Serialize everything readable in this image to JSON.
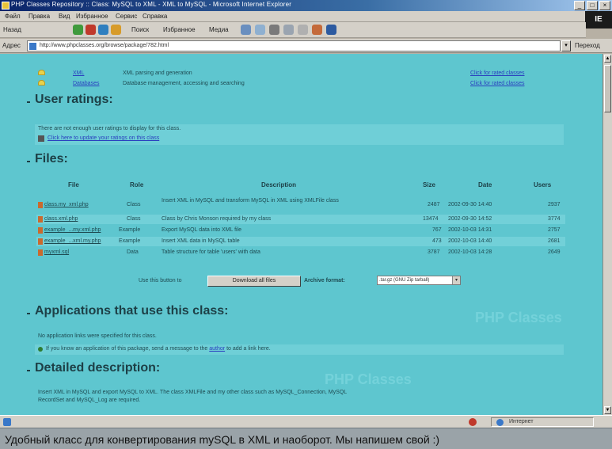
{
  "caption": "Удобный класс для конвертирования mySQL в XML и наоборот. Мы напишем свой :)",
  "window": {
    "title": "PHP Classes Repository :: Class: MySQL to XML - XML to MySQL - Microsoft Internet Explorer",
    "minimize": "_",
    "maximize": "□",
    "close": "×"
  },
  "menubar": {
    "items": [
      "Файл",
      "Правка",
      "Вид",
      "Избранное",
      "Сервис",
      "Справка"
    ],
    "logo": "IE"
  },
  "toolbar": {
    "back_label": "Назад",
    "search_label": "Поиск",
    "favorites_label": "Избранное",
    "media_label": "Медиа"
  },
  "address": {
    "label": "Адрес",
    "url": "http://www.phpclasses.org/browse/package/782.html",
    "go_label": "Переход"
  },
  "topics": [
    {
      "name": "XML",
      "description": "XML parsing and generation",
      "action": "Click for rated classes"
    },
    {
      "name": "Databases",
      "description": "Database management, accessing and searching",
      "action": "Click for rated classes"
    }
  ],
  "ratings": {
    "heading": "User ratings:",
    "note": "There are not enough user ratings to display for this class.",
    "link": "Click here to update your ratings on this class"
  },
  "files": {
    "heading": "Files:",
    "columns": {
      "file": "File",
      "role": "Role",
      "description": "Description",
      "size": "Size",
      "date": "Date",
      "users": "Users"
    },
    "rows": [
      {
        "file": "class.my_xml.php",
        "role": "Class",
        "description": "Insert XML in MySQL and transform MySQL in XML using XMLFile class",
        "size": "2487",
        "date": "2002-09-30 14:40",
        "users": "2937"
      },
      {
        "file": "class.xml.php",
        "role": "Class",
        "description": "Class by Chris Monson required by my class",
        "size": "13474",
        "date": "2002-09-30 14:52",
        "users": "3774"
      },
      {
        "file": "example_...my.xml.php",
        "role": "Example",
        "description": "Export MySQL data into XML file",
        "size": "767",
        "date": "2002-10-03 14:31",
        "users": "2757"
      },
      {
        "file": "example_...xml.my.php",
        "role": "Example",
        "description": "Insert XML data in MySQL table",
        "size": "473",
        "date": "2002-10-03 14:40",
        "users": "2681"
      },
      {
        "file": "myxml.sql",
        "role": "Data",
        "description": "Table structure for table 'users' with data",
        "size": "3787",
        "date": "2002-10-03 14:28",
        "users": "2649"
      }
    ],
    "download_prefix": "Use this button to",
    "download_button": "Download all files",
    "archive_label": "Archive format:",
    "archive_selected": ".tar.gz (GNU Zip tarball)"
  },
  "applications": {
    "heading": "Applications that use this class:",
    "note": "No application links were specified for this class.",
    "tip_prefix": "If you know an application of this package, send a message to the",
    "tip_link": "author",
    "tip_suffix": "to add a link here."
  },
  "detailed": {
    "heading": "Detailed description:",
    "text_line1": "Insert XML in MySQL and export MySQL to XML. The class XMLFile and my other class such as MySQL_Connection, MySQL",
    "text_line2": "RecordSet and MySQL_Log are required."
  },
  "watermarks": [
    "PHP Classes",
    "PHP Classes"
  ],
  "statusbar": {
    "zone": "Интернет"
  }
}
